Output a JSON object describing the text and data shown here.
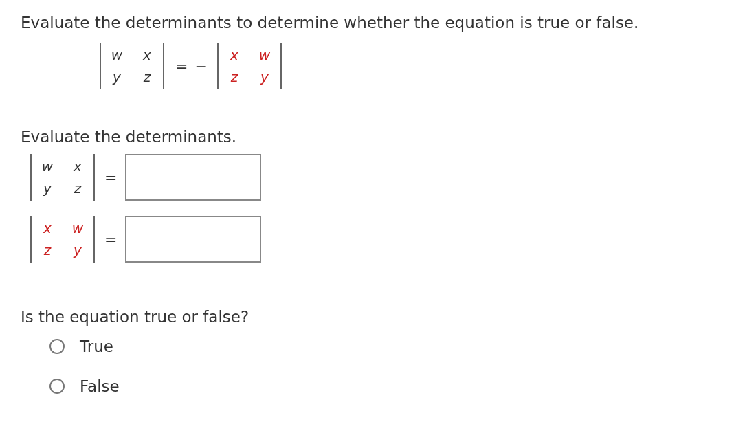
{
  "question": "Evaluate the determinants to determine whether the equation is true or false.",
  "equation": {
    "left": {
      "rows": [
        [
          {
            "text": "w",
            "color": "#333333"
          },
          {
            "text": "x",
            "color": "#333333"
          }
        ],
        [
          {
            "text": "y",
            "color": "#333333"
          },
          {
            "text": "z",
            "color": "#333333"
          }
        ]
      ]
    },
    "equals": "=",
    "minus": "−",
    "right": {
      "rows": [
        [
          {
            "text": "x",
            "color": "#cc2222"
          },
          {
            "text": "w",
            "color": "#cc2222"
          }
        ],
        [
          {
            "text": "z",
            "color": "#cc2222"
          },
          {
            "text": "y",
            "color": "#cc2222"
          }
        ]
      ]
    }
  },
  "instruction": "Evaluate the determinants.",
  "answers": [
    {
      "matrix": {
        "rows": [
          [
            {
              "text": "w",
              "color": "#333333"
            },
            {
              "text": "x",
              "color": "#333333"
            }
          ],
          [
            {
              "text": "y",
              "color": "#333333"
            },
            {
              "text": "z",
              "color": "#333333"
            }
          ]
        ]
      },
      "equals": "="
    },
    {
      "matrix": {
        "rows": [
          [
            {
              "text": "x",
              "color": "#cc2222"
            },
            {
              "text": "w",
              "color": "#cc2222"
            }
          ],
          [
            {
              "text": "z",
              "color": "#cc2222"
            },
            {
              "text": "y",
              "color": "#cc2222"
            }
          ]
        ]
      },
      "equals": "="
    }
  ],
  "prompt": "Is the equation true or false?",
  "options": [
    {
      "label": "True",
      "selected": false
    },
    {
      "label": "False",
      "selected": false
    }
  ]
}
